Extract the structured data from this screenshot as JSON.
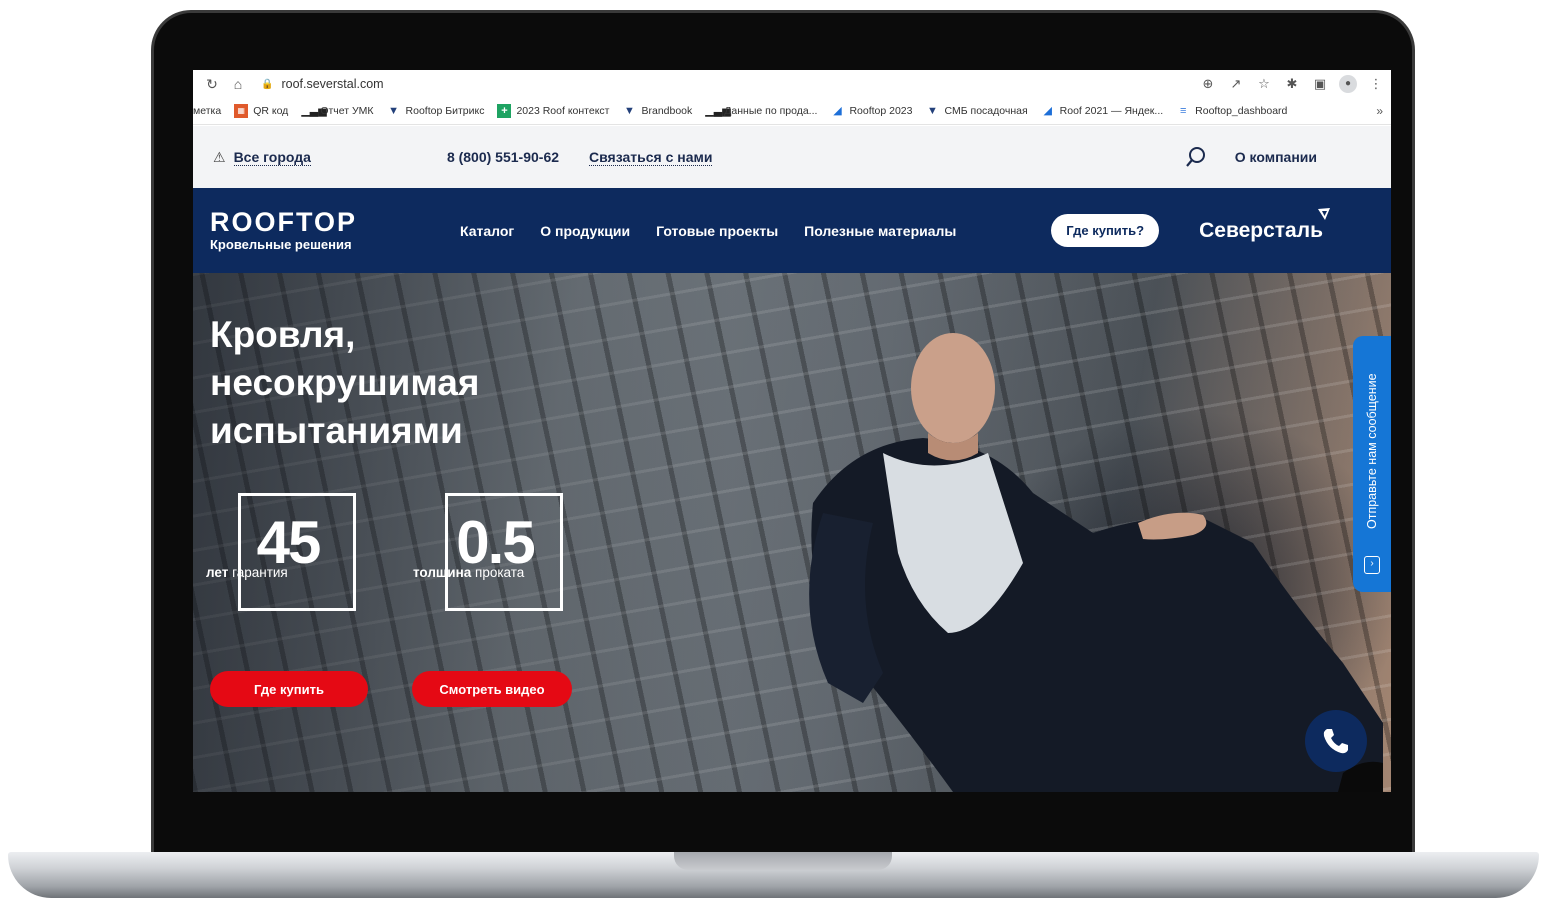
{
  "browser": {
    "url": "roof.severstal.com",
    "bookmarks": [
      {
        "label": "метка",
        "icon": "none"
      },
      {
        "label": "QR код",
        "icon": "qr-icon"
      },
      {
        "label": "Отчет УМК",
        "icon": "bar-chart-icon"
      },
      {
        "label": "Rooftop Битрикс",
        "icon": "shield-icon"
      },
      {
        "label": "2023 Roof контекст",
        "icon": "sheet-icon"
      },
      {
        "label": "Brandbook",
        "icon": "shield-icon"
      },
      {
        "label": "Данные по прода...",
        "icon": "bar-chart-icon"
      },
      {
        "label": "Rooftop 2023",
        "icon": "swoosh-icon"
      },
      {
        "label": "СМБ посадочная",
        "icon": "shield-icon"
      },
      {
        "label": "Roof 2021 — Яндек...",
        "icon": "swoosh-icon"
      },
      {
        "label": "Rooftop_dashboard",
        "icon": "dashboard-icon"
      }
    ],
    "bookmarks_more": "»"
  },
  "topbar": {
    "cities": "Все города",
    "phone": "8 (800) 551-90-62",
    "contact": "Связаться с нами",
    "about": "О компании"
  },
  "nav": {
    "logo_word": "ROOFTOP",
    "logo_sub": "Кровельные решения",
    "links": [
      "Каталог",
      "О продукции",
      "Готовые проекты",
      "Полезные материалы"
    ],
    "buy_button": "Где купить?",
    "brand": "Северсталь"
  },
  "hero": {
    "title_lines": [
      "Кровля,",
      "несокрушимая",
      "испытаниями"
    ],
    "stats": [
      {
        "value": "45",
        "caption_bold": "лет",
        "caption_rest": " гарантия"
      },
      {
        "value": "0.5",
        "caption_bold": "толщина",
        "caption_rest": " проката"
      }
    ],
    "cta_buy": "Где купить",
    "cta_video": "Смотреть видео",
    "message_tab": "Отправьте нам сообщение"
  },
  "colors": {
    "navy": "#0d2a5e",
    "accent_red": "#e50914",
    "message_blue": "#1576d6"
  }
}
